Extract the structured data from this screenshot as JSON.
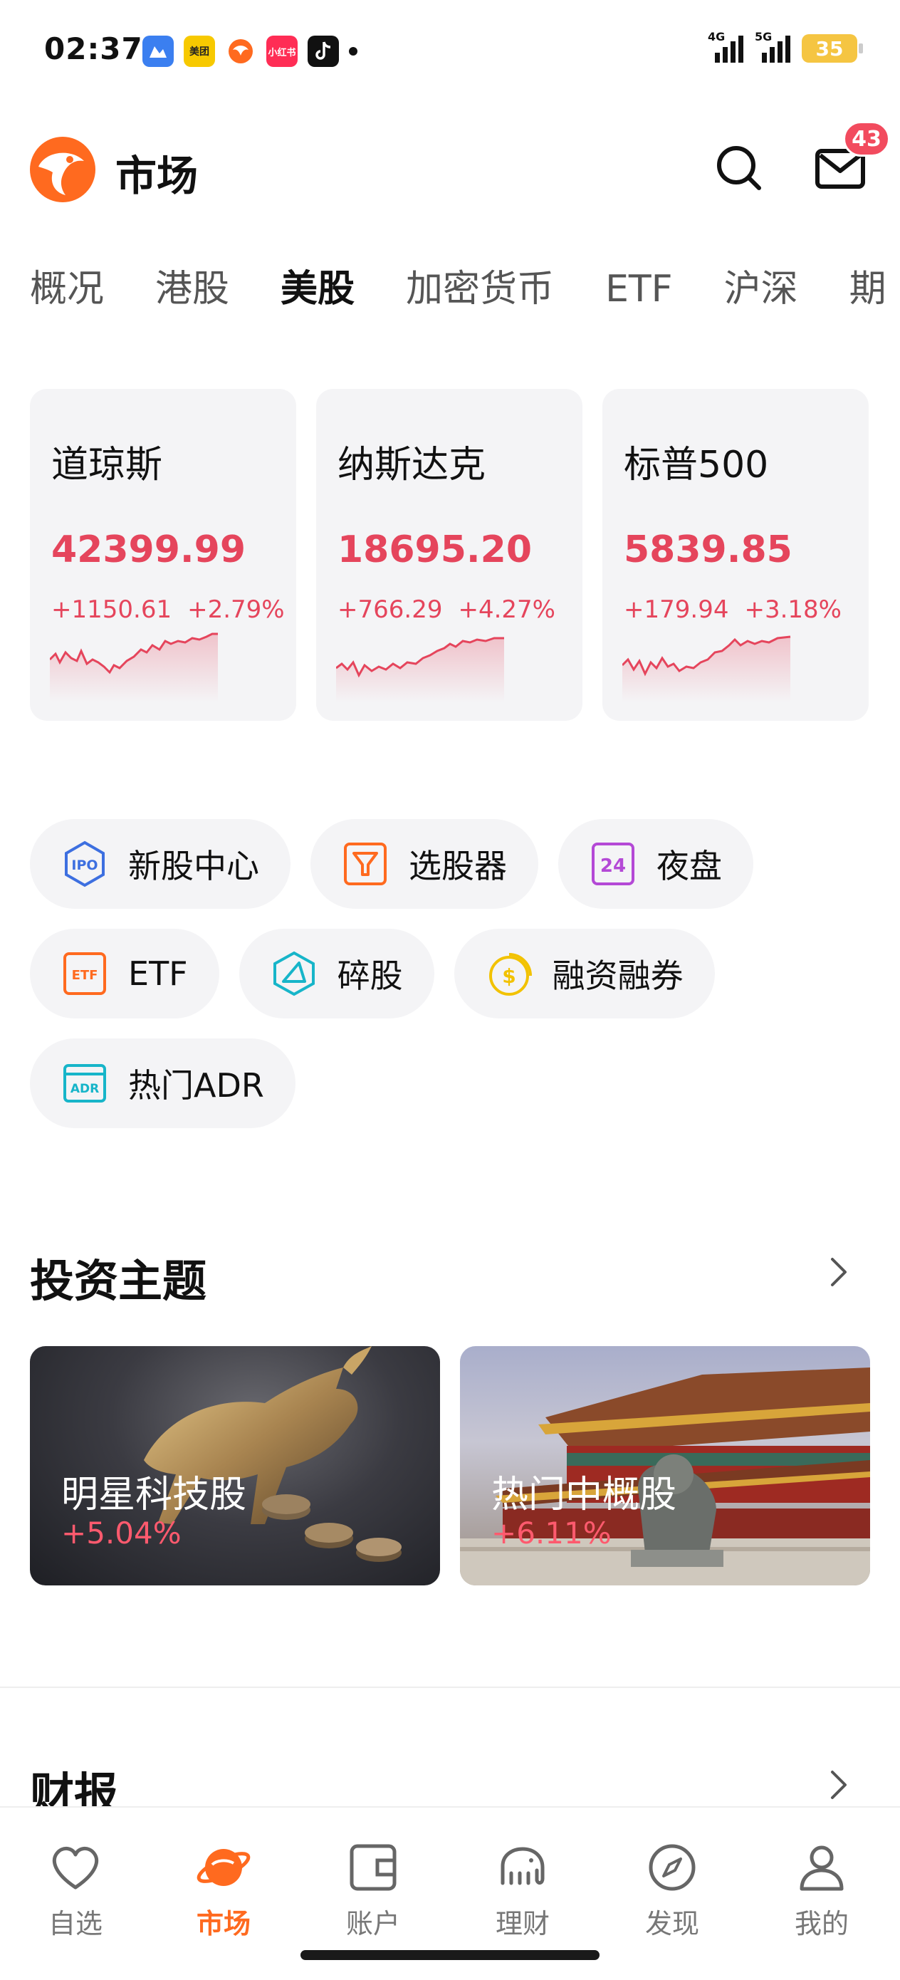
{
  "status_bar": {
    "time": "02:37",
    "notif_labels": [
      "美团",
      "小红书"
    ],
    "signal_labels": [
      "4G",
      "5G"
    ],
    "battery": "35"
  },
  "header": {
    "title": "市场",
    "badge_count": "43"
  },
  "tabs": [
    {
      "label": "概况",
      "active": false
    },
    {
      "label": "港股",
      "active": false
    },
    {
      "label": "美股",
      "active": true
    },
    {
      "label": "加密货币",
      "active": false
    },
    {
      "label": "ETF",
      "active": false
    },
    {
      "label": "沪深",
      "active": false
    },
    {
      "label": "期",
      "active": false
    }
  ],
  "indices": [
    {
      "name": "道琼斯",
      "value": "42399.99",
      "change": "+1150.61",
      "percent": "+2.79%"
    },
    {
      "name": "纳斯达克",
      "value": "18695.20",
      "change": "+766.29",
      "percent": "+4.27%"
    },
    {
      "name": "标普500",
      "value": "5839.85",
      "change": "+179.94",
      "percent": "+3.18%"
    }
  ],
  "shortcuts": [
    {
      "label": "新股中心",
      "icon": "ipo-icon"
    },
    {
      "label": "选股器",
      "icon": "stock-filter-icon"
    },
    {
      "label": "夜盘",
      "icon": "night-session-icon"
    },
    {
      "label": "ETF",
      "icon": "etf-icon"
    },
    {
      "label": "碎股",
      "icon": "odd-lot-icon"
    },
    {
      "label": "融资融券",
      "icon": "margin-icon"
    },
    {
      "label": "热门ADR",
      "icon": "adr-icon"
    }
  ],
  "icon_text": {
    "ipo": "IPO",
    "etf": "ETF",
    "adr": "ADR",
    "night": "24"
  },
  "themes_section": {
    "title": "投资主题",
    "items": [
      {
        "name": "明星科技股",
        "change": "+5.04%"
      },
      {
        "name": "热门中概股",
        "change": "+6.11%"
      }
    ]
  },
  "earnings_section": {
    "title": "财报"
  },
  "bottom_nav": [
    {
      "label": "自选",
      "icon": "heart-icon",
      "active": false
    },
    {
      "label": "市场",
      "icon": "planet-icon",
      "active": true
    },
    {
      "label": "账户",
      "icon": "wallet-icon",
      "active": false
    },
    {
      "label": "理财",
      "icon": "elephant-icon",
      "active": false
    },
    {
      "label": "发现",
      "icon": "compass-icon",
      "active": false
    },
    {
      "label": "我的",
      "icon": "person-icon",
      "active": false
    }
  ],
  "colors": {
    "up": "#e5455c",
    "accent": "#ff6a1f",
    "card_bg": "#f4f4f6"
  }
}
